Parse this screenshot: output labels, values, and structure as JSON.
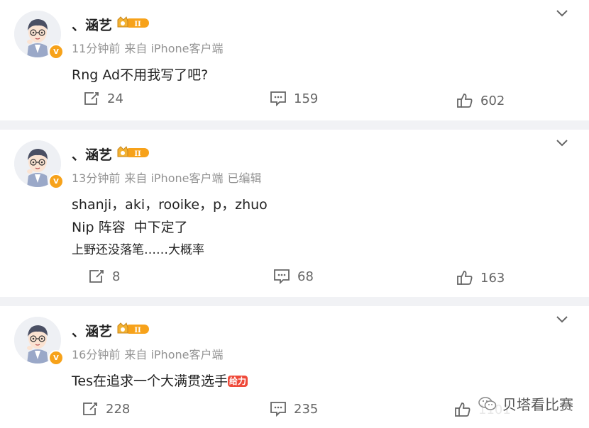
{
  "posts": [
    {
      "author": "、涵艺",
      "level": "II",
      "time": "11分钟前",
      "source": "来自 iPhone客户端",
      "edited": "",
      "lines": [
        "Rng Ad不用我写了吧?"
      ],
      "reposts": "24",
      "comments": "159",
      "likes": "602"
    },
    {
      "author": "、涵艺",
      "level": "II",
      "time": "13分钟前",
      "source": "来自 iPhone客户端",
      "edited": "已编辑",
      "lines": [
        "shanji，aki，rooike，p，zhuo",
        "Nip 阵容  中下定了",
        "上野还没落笔……大概率"
      ],
      "reposts": "8",
      "comments": "68",
      "likes": "163"
    },
    {
      "author": "、涵艺",
      "level": "II",
      "time": "16分钟前",
      "source": "来自 iPhone客户端",
      "edited": "",
      "lines": [
        "Tes在追求一个大满贯选手"
      ],
      "emoji": "给力",
      "reposts": "228",
      "comments": "235",
      "likes": "1101"
    }
  ],
  "verified_badge": "V",
  "watermark": "贝塔看比赛",
  "colors": {
    "background": "#f1f2f5",
    "card": "#ffffff",
    "meta": "#939393",
    "gold": "#f7a21a",
    "emoji": "#ef4a3a"
  }
}
